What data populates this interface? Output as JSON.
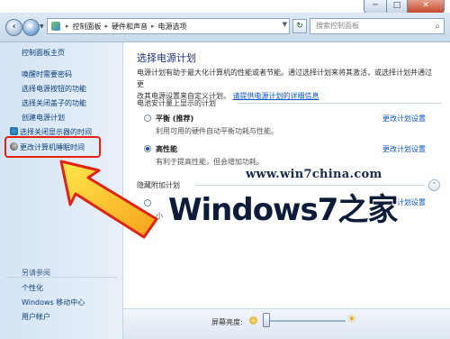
{
  "window": {
    "minimize_glyph": "─",
    "maximize_glyph": "□",
    "close_glyph": "✕"
  },
  "address": {
    "crumbs": [
      "控制面板",
      "硬件和声音",
      "电源选项"
    ],
    "separator": "▸",
    "search_placeholder": "搜索控制面板"
  },
  "sidebar": {
    "home": "控制面板主页",
    "items": [
      "唤醒时需要密码",
      "选择电源按钮的功能",
      "选择关闭盖子的功能",
      "创建电源计划",
      "选择关闭显示器的时间",
      "更改计算机睡眠时间"
    ],
    "see_also_title": "另请参阅",
    "see_also": [
      "个性化",
      "Windows 移动中心",
      "用户帐户"
    ]
  },
  "main": {
    "title": "选择电源计划",
    "description_1": "电源计划有助于最大化计算机的性能或者节能。通过选择计划来将其激活，或选择计划并通过更",
    "description_2": "改其电源设置来自定义计划。",
    "description_link": "请提供电源计划的详细信息",
    "section1_title": "电池安计量上显示的计划",
    "plans": [
      {
        "name": "平衡 (推荐)",
        "desc": "利用可用的硬件自动平衡功耗与性能。",
        "link": "更改计划设置",
        "selected": false
      },
      {
        "name": "高性能",
        "desc": "有利于提高性能，但会增加功耗。",
        "link": "更改计划设置",
        "selected": true
      }
    ],
    "section2_title": "隐藏附加计划",
    "hidden_plan": {
      "name": "",
      "desc": "小",
      "link": "更改计划设置"
    }
  },
  "watermark": {
    "url": "www.win7china.com",
    "brand": "Windows7之家"
  },
  "brightness": {
    "label": "屏幕亮度:",
    "level": 0.05
  }
}
